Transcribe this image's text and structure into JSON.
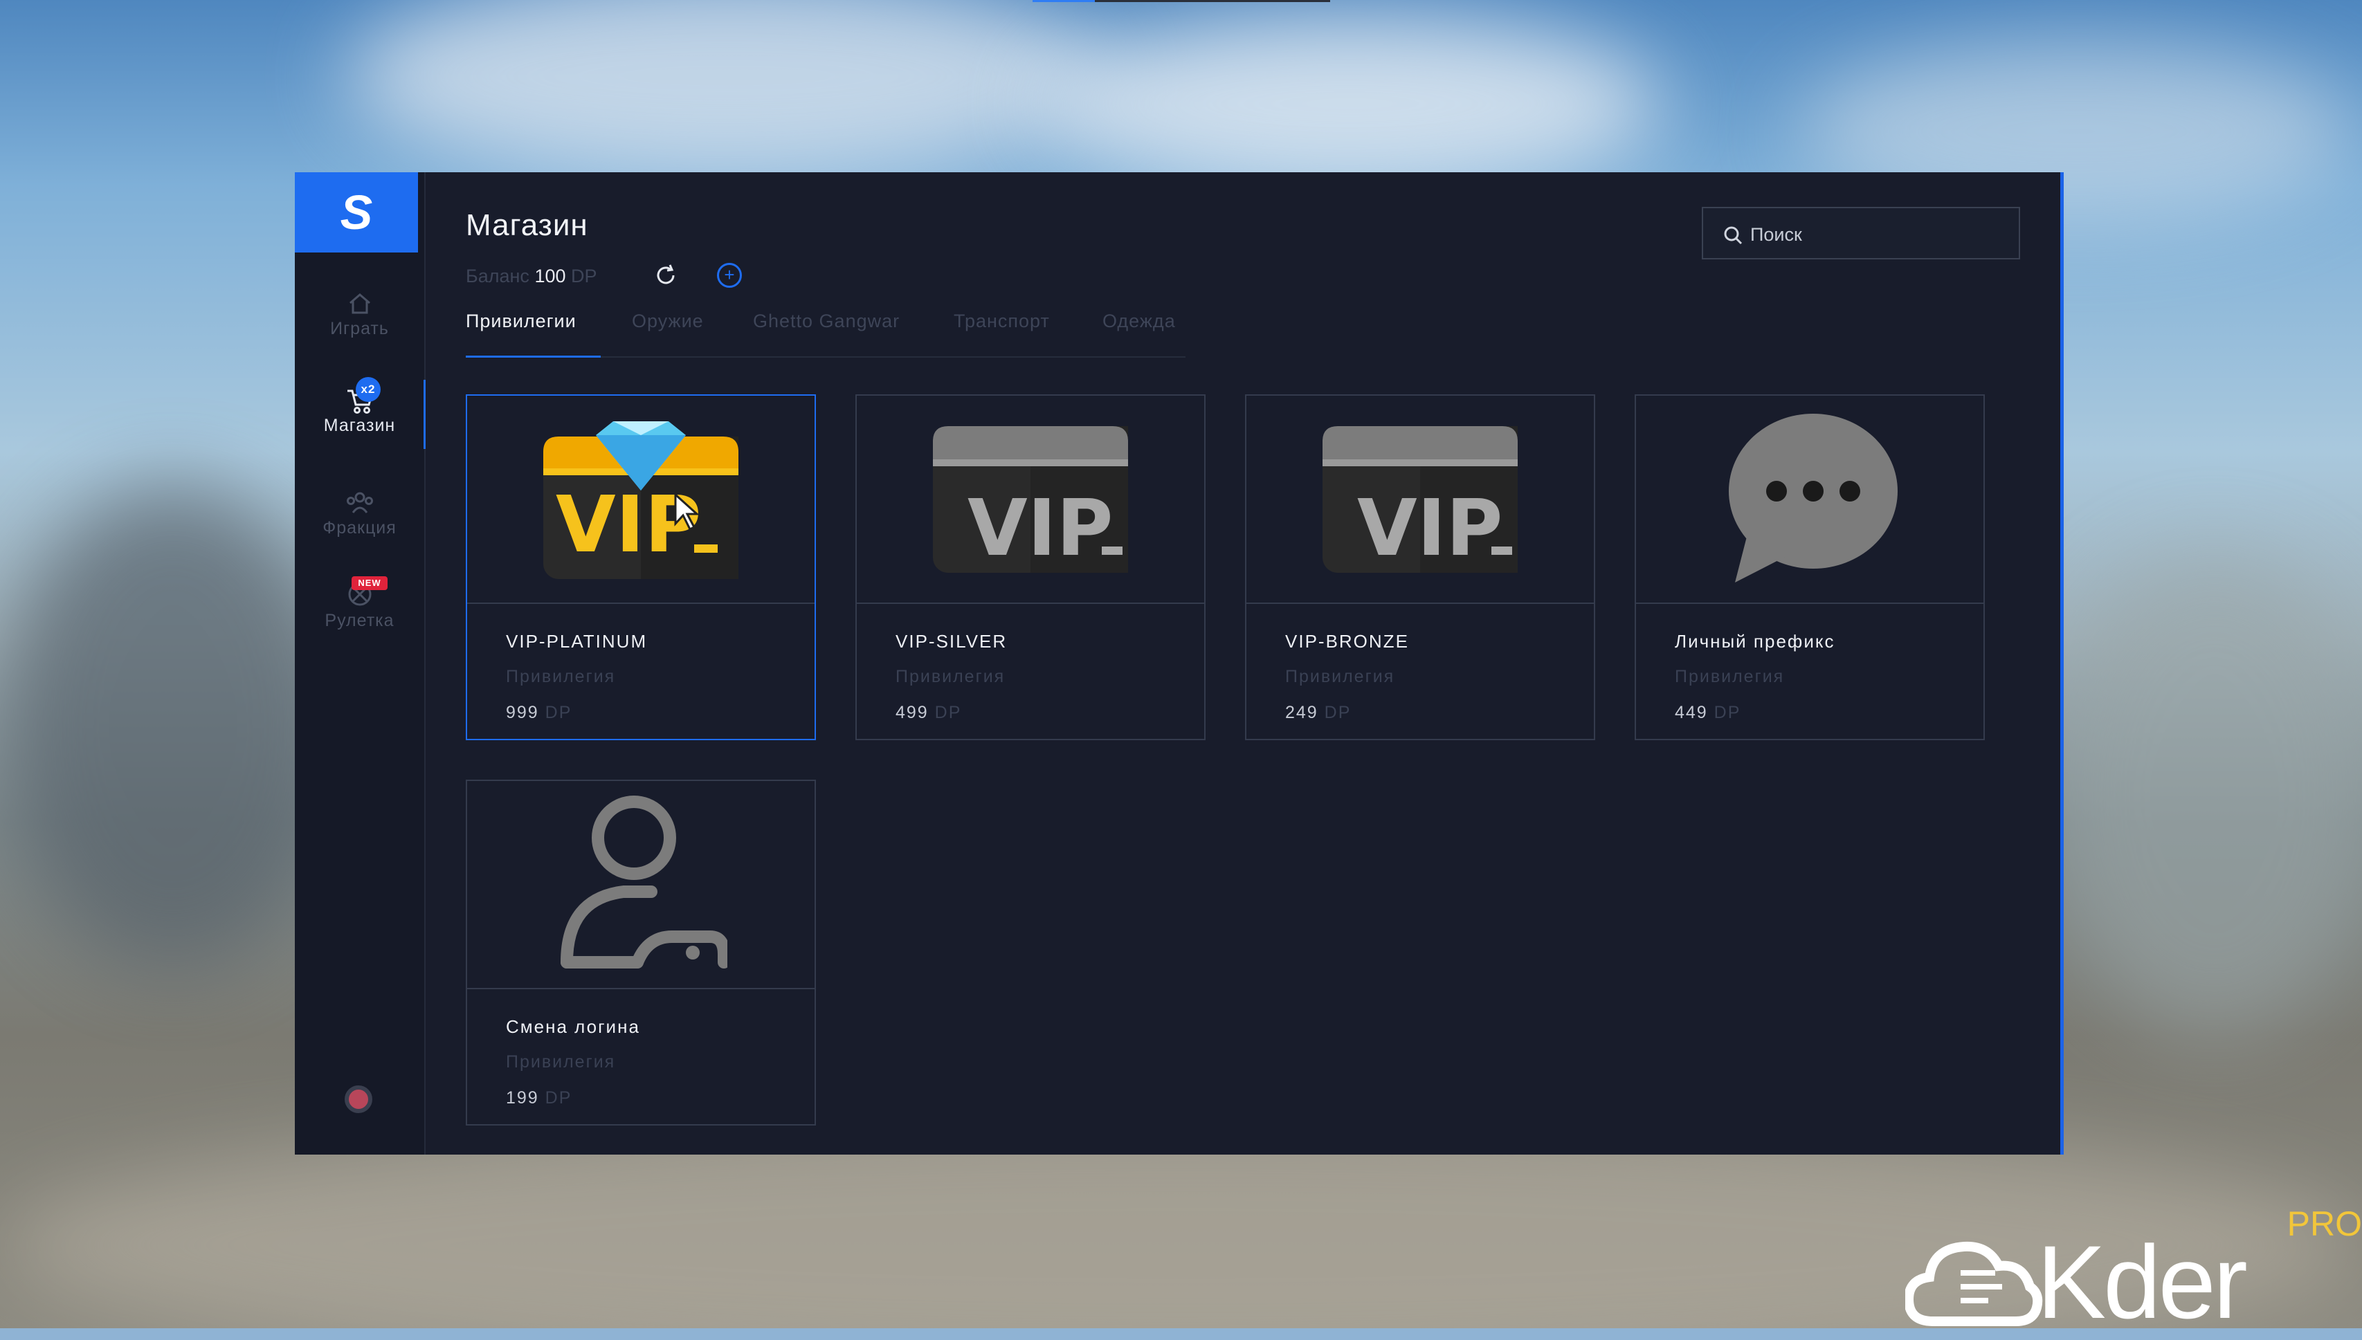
{
  "app": {
    "logo_letter": "S"
  },
  "sidebar": {
    "items": [
      {
        "label": "Играть",
        "icon": "home-icon"
      },
      {
        "label": "Магазин",
        "icon": "cart-icon",
        "badge": "x2",
        "active": true
      },
      {
        "label": "Фракция",
        "icon": "group-icon"
      },
      {
        "label": "Рулетка",
        "icon": "roulette-icon",
        "badge": "NEW"
      }
    ],
    "settings_icon": "settings-icon"
  },
  "header": {
    "title": "Магазин",
    "balance_label": "Баланс",
    "balance_value": "100",
    "balance_currency": "DP"
  },
  "search": {
    "placeholder": "Поиск"
  },
  "tabs": [
    {
      "label": "Привилегии",
      "active": true
    },
    {
      "label": "Оружие"
    },
    {
      "label": "Ghetto Gangwar"
    },
    {
      "label": "Транспорт"
    },
    {
      "label": "Одежда"
    }
  ],
  "items": [
    {
      "name": "VIP-PLATINUM",
      "category": "Привилегия",
      "price": "999",
      "currency": "DP",
      "icon": "vip-gold-diamond-icon",
      "selected": true
    },
    {
      "name": "VIP-SILVER",
      "category": "Привилегия",
      "price": "499",
      "currency": "DP",
      "icon": "vip-silver-icon"
    },
    {
      "name": "VIP-BRONZE",
      "category": "Привилегия",
      "price": "249",
      "currency": "DP",
      "icon": "vip-bronze-icon"
    },
    {
      "name": "Личный префикс",
      "category": "Привилегия",
      "price": "449",
      "currency": "DP",
      "icon": "speech-bubble-icon"
    },
    {
      "name": "Смена логина",
      "category": "Привилегия",
      "price": "199",
      "currency": "DP",
      "icon": "user-key-icon"
    }
  ],
  "colors": {
    "accent": "#1e6cf0",
    "panel": "#181c2b",
    "sidebar": "#151927",
    "badge_red": "#e0233b"
  },
  "watermark": {
    "text": "Kder",
    "tag": "PRO"
  }
}
